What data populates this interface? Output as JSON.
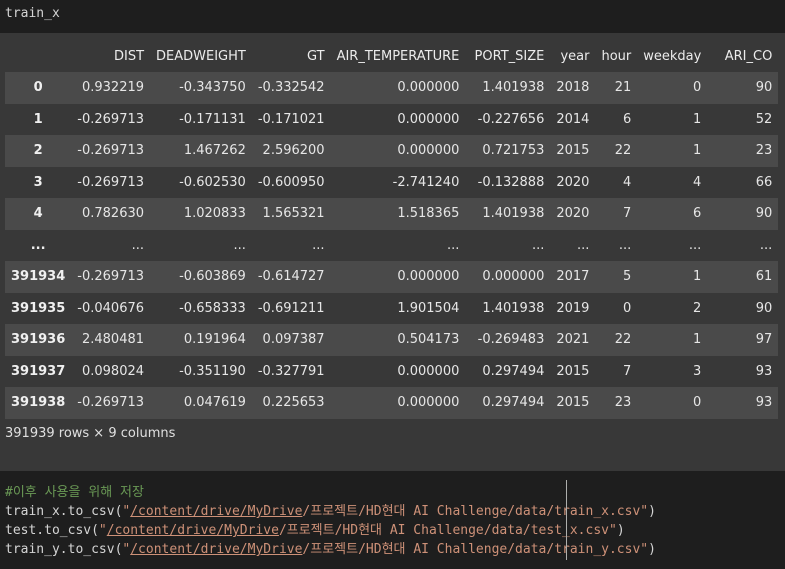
{
  "cell_label": "train_x",
  "table": {
    "columns": [
      "",
      "DIST",
      "DEADWEIGHT",
      "GT",
      "AIR_TEMPERATURE",
      "PORT_SIZE",
      "year",
      "hour",
      "weekday",
      "ARI_CO"
    ],
    "rows": [
      [
        "0",
        "0.932219",
        "-0.343750",
        "-0.332542",
        "0.000000",
        "1.401938",
        "2018",
        "21",
        "0",
        "90"
      ],
      [
        "1",
        "-0.269713",
        "-0.171131",
        "-0.171021",
        "0.000000",
        "-0.227656",
        "2014",
        "6",
        "1",
        "52"
      ],
      [
        "2",
        "-0.269713",
        "1.467262",
        "2.596200",
        "0.000000",
        "0.721753",
        "2015",
        "22",
        "1",
        "23"
      ],
      [
        "3",
        "-0.269713",
        "-0.602530",
        "-0.600950",
        "-2.741240",
        "-0.132888",
        "2020",
        "4",
        "4",
        "66"
      ],
      [
        "4",
        "0.782630",
        "1.020833",
        "1.565321",
        "1.518365",
        "1.401938",
        "2020",
        "7",
        "6",
        "90"
      ],
      [
        "...",
        "...",
        "...",
        "...",
        "...",
        "...",
        "...",
        "...",
        "...",
        "..."
      ],
      [
        "391934",
        "-0.269713",
        "-0.603869",
        "-0.614727",
        "0.000000",
        "0.000000",
        "2017",
        "5",
        "1",
        "61"
      ],
      [
        "391935",
        "-0.040676",
        "-0.658333",
        "-0.691211",
        "1.901504",
        "1.401938",
        "2019",
        "0",
        "2",
        "90"
      ],
      [
        "391936",
        "2.480481",
        "0.191964",
        "0.097387",
        "0.504173",
        "-0.269483",
        "2021",
        "22",
        "1",
        "97"
      ],
      [
        "391937",
        "0.098024",
        "-0.351190",
        "-0.327791",
        "0.000000",
        "0.297494",
        "2015",
        "7",
        "3",
        "93"
      ],
      [
        "391938",
        "-0.269713",
        "0.047619",
        "0.225653",
        "0.000000",
        "0.297494",
        "2015",
        "23",
        "0",
        "93"
      ]
    ]
  },
  "shape_text": "391939 rows × 9 columns",
  "code": {
    "comment": "#이후 사용을 위해 저장",
    "lines": [
      {
        "prefix": "train_x.to_csv(",
        "q1": "\"",
        "path": "/content/drive/MyDrive",
        "rest": "/프로젝트/HD현대 AI Challenge/data/train_x.csv\"",
        "suffix": ")"
      },
      {
        "prefix": "test.to_csv(",
        "q1": "\"",
        "path": "/content/drive/MyDrive",
        "rest": "/프로젝트/HD현대 AI Challenge/data/test_x.csv\"",
        "suffix": ")"
      },
      {
        "prefix": "train_y.to_csv(",
        "q1": "\"",
        "path": "/content/drive/MyDrive",
        "rest": "/프로젝트/HD현대 AI Challenge/data/train_y.csv\"",
        "suffix": ")"
      }
    ]
  }
}
